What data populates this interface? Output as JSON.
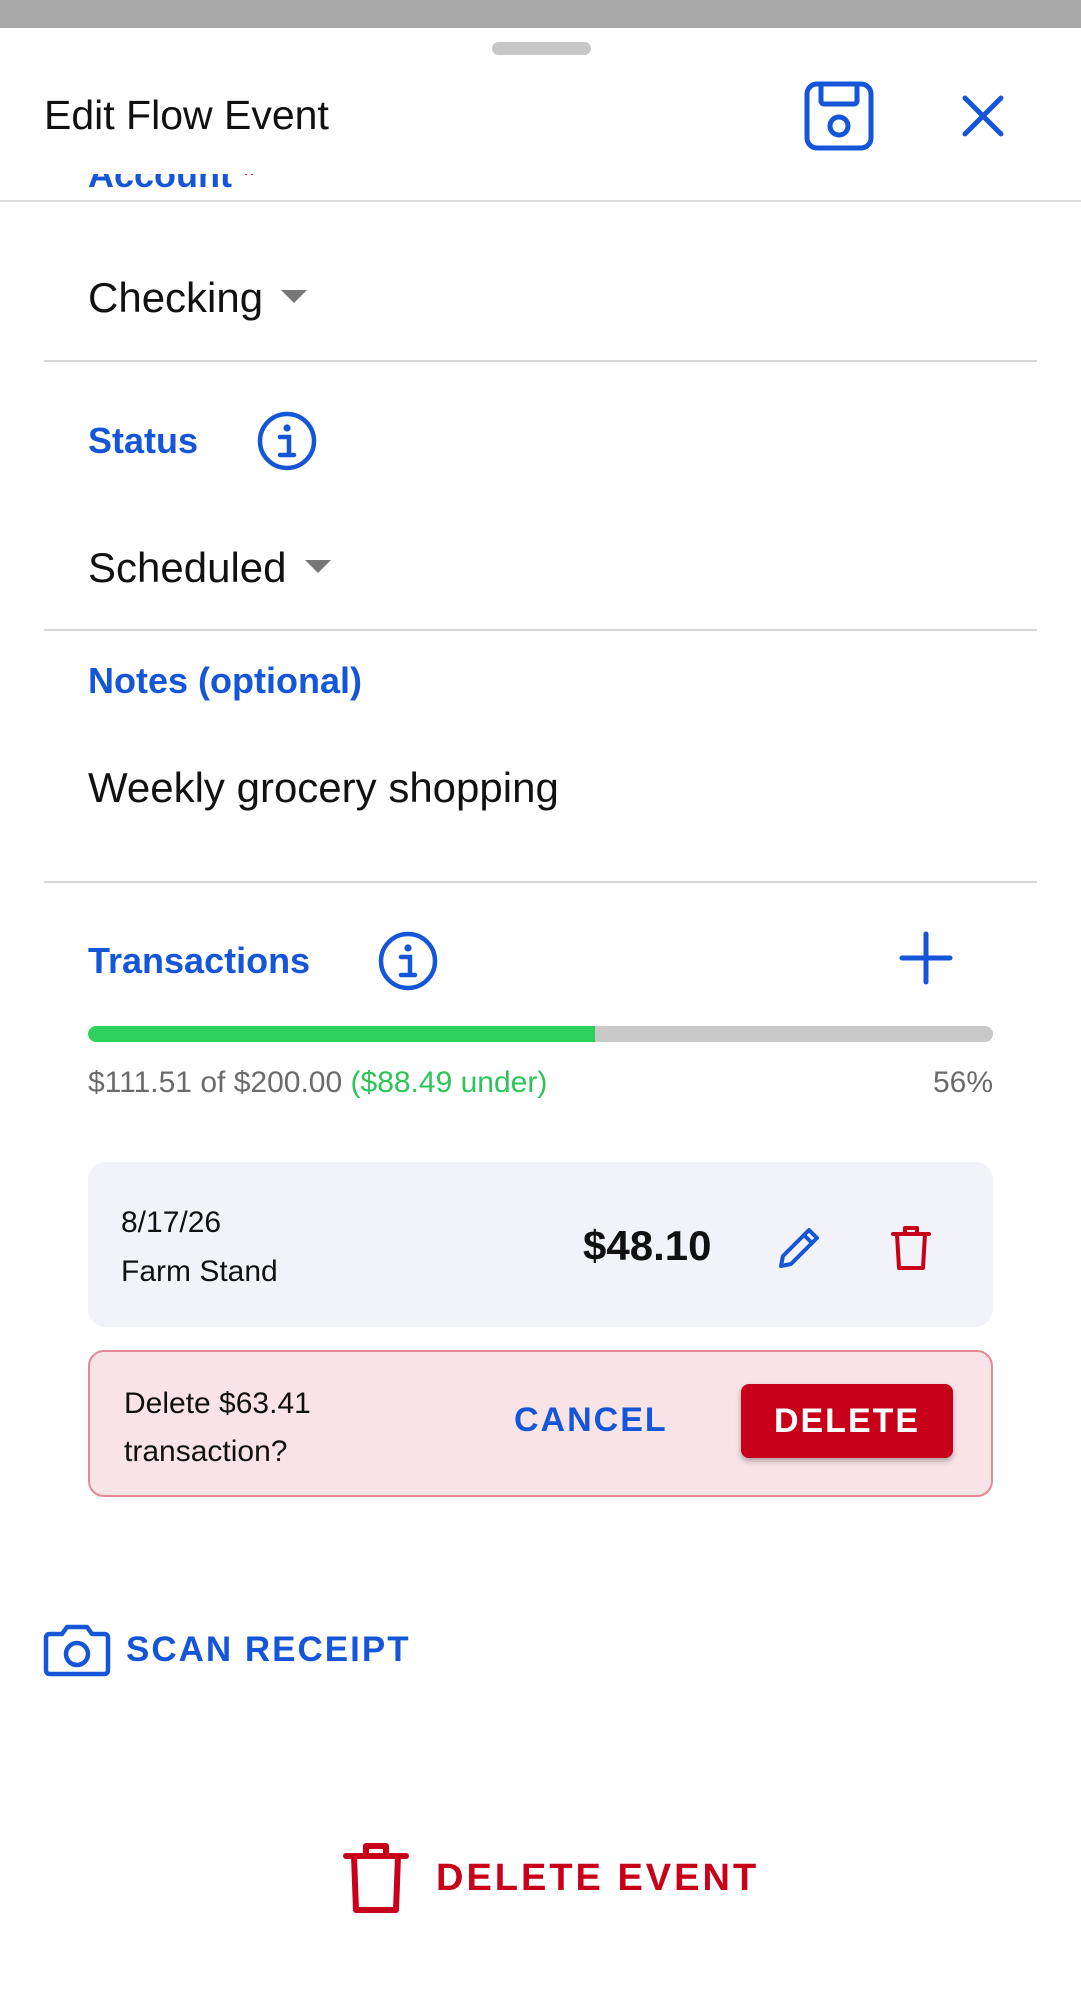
{
  "header": {
    "title": "Edit Flow Event",
    "save_icon": "floppy-disk-save-icon",
    "close_icon": "close-x-icon"
  },
  "account": {
    "label": "Account",
    "required_mark": "*",
    "value": "Checking"
  },
  "status": {
    "label": "Status",
    "value": "Scheduled"
  },
  "notes": {
    "label": "Notes (optional)",
    "value": "Weekly grocery shopping"
  },
  "transactions": {
    "label": "Transactions",
    "progress": {
      "spent": "$111.51",
      "of": "of",
      "budget": "$200.00",
      "under": "($88.49 under)",
      "percent_label": "56%",
      "fraction": 0.56
    },
    "items": [
      {
        "date": "8/17/26",
        "merchant": "Farm Stand",
        "amount": "$48.10"
      }
    ],
    "confirm": {
      "message": "Delete $63.41 transaction?",
      "cancel_label": "CANCEL",
      "delete_label": "DELETE"
    }
  },
  "scan_receipt": {
    "label": "SCAN RECEIPT"
  },
  "delete_event": {
    "label": "DELETE EVENT"
  },
  "colors": {
    "accent": "#1556d8",
    "danger": "#c8001a",
    "progress_fill": "#2ed15e",
    "progress_track": "#c9c9c9",
    "under_text": "#2ec45a"
  }
}
